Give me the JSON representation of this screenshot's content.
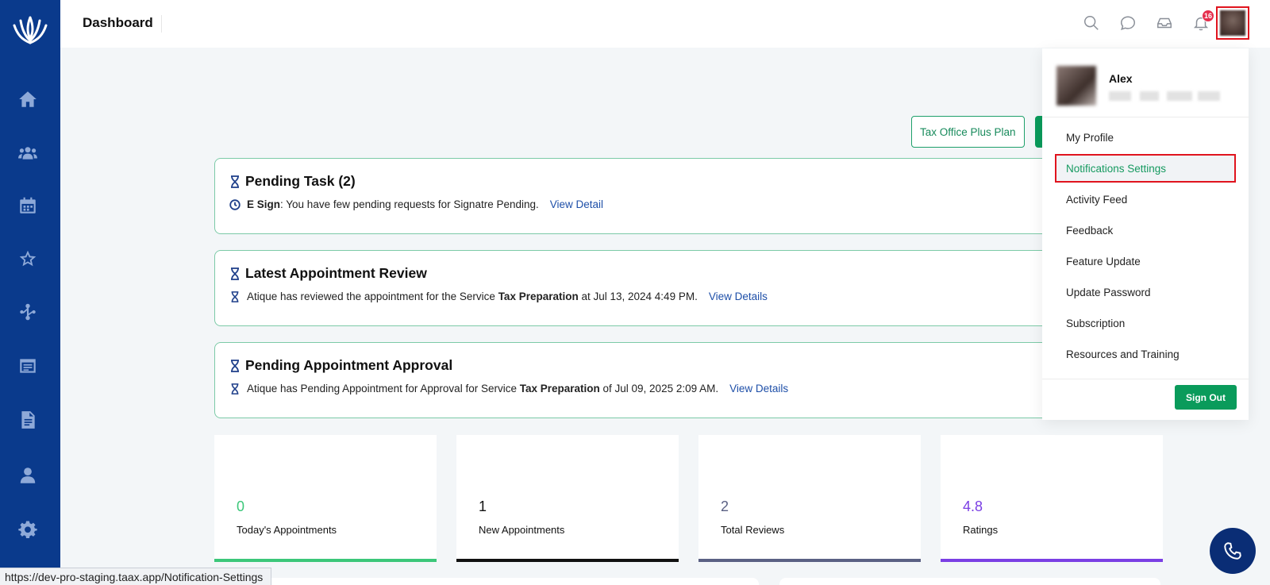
{
  "header": {
    "title": "Dashboard"
  },
  "topbar": {
    "icons": [
      "search-icon",
      "chat-icon",
      "inbox-icon",
      "bell-icon"
    ],
    "notification_count": "16"
  },
  "plan_button": {
    "label": "Tax Office Plus Plan"
  },
  "cards": [
    {
      "title": "Pending Task (2)",
      "prefix_bold": "E Sign",
      "text": ": You have few pending requests for Signatre Pending.",
      "link": "View Detail"
    },
    {
      "title": "Latest Appointment Review",
      "text_before": "Atique has reviewed the appointment for the Service ",
      "bold": "Tax Preparation",
      "text_after": " at Jul 13, 2024 4:49 PM.",
      "link": "View Details"
    },
    {
      "title": "Pending Appointment Approval",
      "text_before": "Atique has Pending Appointment for Approval for Service ",
      "bold": "Tax Preparation",
      "text_after": " of Jul 09, 2025 2:09 AM.",
      "link": "View Details"
    }
  ],
  "stats": [
    {
      "value": "0",
      "label": "Today's Appointments",
      "color": "#3cc77a"
    },
    {
      "value": "1",
      "label": "New Appointments",
      "color": "#111111"
    },
    {
      "value": "2",
      "label": "Total Reviews",
      "color": "#5b6184"
    },
    {
      "value": "4.8",
      "label": "Ratings",
      "color": "#7b3fe4"
    }
  ],
  "profile_menu": {
    "user_name": "Alex",
    "items": [
      "My Profile",
      "Notifications Settings",
      "Activity Feed",
      "Feedback",
      "Feature Update",
      "Update Password",
      "Subscription",
      "Resources and Training"
    ],
    "sign_out": "Sign Out"
  },
  "status_url": "https://dev-pro-staging.taax.app/Notification-Settings",
  "colors": {
    "sidebar": "#0a3a8c",
    "accent_green": "#0a9b5b",
    "highlight_red": "#e0141e"
  }
}
